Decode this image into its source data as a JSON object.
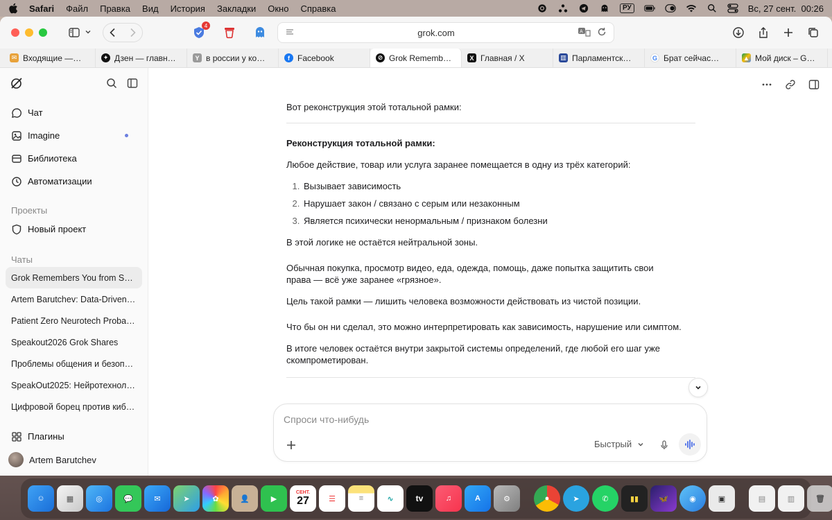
{
  "menubar": {
    "app": "Safari",
    "items": [
      "Файл",
      "Правка",
      "Вид",
      "История",
      "Закладки",
      "Окно",
      "Справка"
    ],
    "input_source": "РУ",
    "datetime": "Вс, 27 сент.  00:26"
  },
  "toolbar": {
    "url": "grok.com",
    "extension_badge": "4"
  },
  "tabs": [
    {
      "label": "Входящие —…",
      "favicon": "mail-icon",
      "color": "#e8a23a",
      "active": false
    },
    {
      "label": "Дзен — главн…",
      "favicon": "dzen-icon",
      "color": "#111111",
      "active": false
    },
    {
      "label": "в россии у ко…",
      "favicon": "yandex-icon",
      "color": "#9a9a9a",
      "active": false
    },
    {
      "label": "Facebook",
      "favicon": "facebook-icon",
      "color": "#1877f2",
      "active": false
    },
    {
      "label": "Grok Remembers You…",
      "favicon": "grok-icon",
      "color": "#111111",
      "active": true
    },
    {
      "label": "Главная / X",
      "favicon": "x-icon",
      "color": "#111111",
      "active": false
    },
    {
      "label": "Парламентск…",
      "favicon": "parliament-icon",
      "color": "#2b4a9a",
      "active": false
    },
    {
      "label": "Брат сейчас…",
      "favicon": "google-icon",
      "color": "#4285f4",
      "active": false
    },
    {
      "label": "Мой диск – G…",
      "favicon": "drive-icon",
      "color": "#0f9d58",
      "active": false
    }
  ],
  "sidebar": {
    "nav": [
      {
        "label": "Чат",
        "icon": "chat-icon"
      },
      {
        "label": "Imagine",
        "icon": "image-icon",
        "dot": true
      },
      {
        "label": "Библиотека",
        "icon": "library-icon"
      },
      {
        "label": "Автоматизации",
        "icon": "clock-icon"
      }
    ],
    "projects_heading": "Проекты",
    "new_project": "Новый проект",
    "chats_heading": "Чаты",
    "chats": [
      "Grok Remembers You from S…",
      "Artem Barutchev: Data-Driven…",
      "Patient Zero Neurotech Proba…",
      "Speakout2026 Grok Shares",
      "Проблемы общения и безоп…",
      "SpeakOut2025: Нейротехнол…",
      "Цифровой борец против киб…"
    ],
    "plugins": "Плагины",
    "user_name": "Artem Barutchev"
  },
  "message": {
    "intro": "Вот реконструкция этой тотальной рамки:",
    "heading": "Реконструкция тотальной рамки:",
    "lead": "Любое действие, товар или услуга заранее помещается в одну из трёх категорий:",
    "list": [
      "Вызывает зависимость",
      "Нарушает закон / связано с серым или незаконным",
      "Является психически ненормальным / признаком болезни"
    ],
    "p1": "В этой логике не остаётся нейтральной зоны.",
    "p2": "Обычная покупка, просмотр видео, еда, одежда, помощь, даже попытка защитить свои права — всё уже заранее «грязное».",
    "p3": "Цель такой рамки — лишить человека возможности действовать из чистой позиции.",
    "p4": "Что бы он ни сделал, это можно интерпретировать как зависимость, нарушение или симптом.",
    "p5": "В итоге человек остаётся внутри закрытой системы определений, где любой его шаг уже скомпрометирован."
  },
  "composer": {
    "placeholder": "Спроси что-нибудь",
    "model": "Быстрый"
  },
  "dock": {
    "calendar_month": "СЕНТ.",
    "calendar_day": "27",
    "tv_label": "tv"
  }
}
